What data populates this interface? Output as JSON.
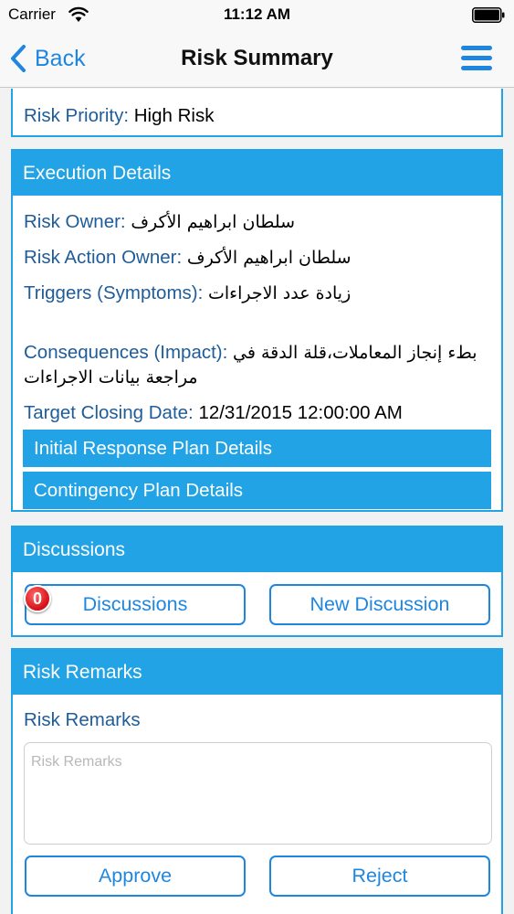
{
  "status_bar": {
    "carrier": "Carrier",
    "time": "11:12 AM"
  },
  "nav": {
    "back_label": "Back",
    "title": "Risk Summary"
  },
  "risk_top": {
    "partial_text": "...",
    "priority_label": "Risk Priority:",
    "priority_value": "High Risk"
  },
  "execution": {
    "header": "Execution Details",
    "fields": [
      {
        "label": "Risk Owner:",
        "value": "سلطان ابراهيم الأكرف"
      },
      {
        "label": "Risk Action Owner:",
        "value": "سلطان ابراهيم الأكرف"
      },
      {
        "label": "Triggers (Symptoms):",
        "value": "زيادة عدد الاجراءات"
      },
      {
        "label": "Consequences (Impact):",
        "value_line1": "بطء إنجاز المعاملات،قلة الدقة في",
        "value_line2": "مراجعة بيانات الاجراءات"
      },
      {
        "label": "Target Closing Date:",
        "value": "12/31/2015 12:00:00 AM"
      }
    ],
    "plans": [
      "Initial Response Plan Details",
      "Contingency Plan Details"
    ]
  },
  "discussions": {
    "header": "Discussions",
    "badge_count": "0",
    "discussions_button": "Discussions",
    "new_discussion_button": "New Discussion"
  },
  "remarks": {
    "header": "Risk Remarks",
    "label": "Risk Remarks",
    "placeholder": "Risk Remarks",
    "approve_button": "Approve",
    "reject_button": "Reject"
  },
  "colors": {
    "accent": "#21a3e6",
    "link": "#1f86e0",
    "label": "#1e5c9a"
  }
}
